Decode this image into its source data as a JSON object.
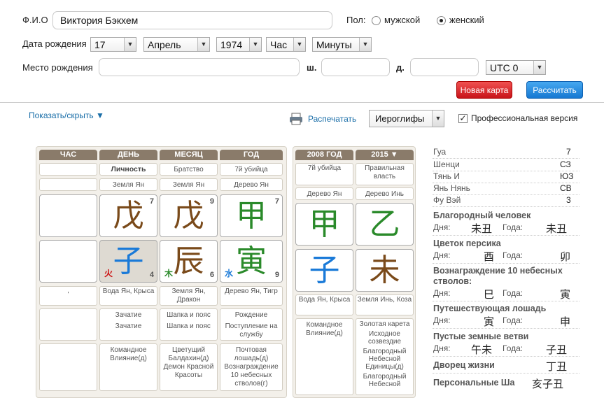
{
  "form": {
    "fio_label": "Ф.И.О",
    "fio_value": "Виктория Бэкхем",
    "gender_label": "Пол:",
    "gender_male": "мужской",
    "gender_female": "женский",
    "dob_label": "Дата рождения",
    "day": "17",
    "month": "Апрель",
    "year": "1974",
    "hour": "Час",
    "minute": "Минуты",
    "place_label": "Место рождения",
    "lat_label": "ш.",
    "lon_label": "д.",
    "tz": "UTC 0",
    "new_chart": "Новая карта",
    "calculate": "Рассчитать"
  },
  "toolbar": {
    "toggle": "Показать/скрыть ▼",
    "print": "Распечатать",
    "mode": "Иероглифы",
    "pro": "Профессиональная версия"
  },
  "pillars": {
    "headers": [
      "ЧАС",
      "ДЕНЬ",
      "МЕСЯЦ",
      "ГОД"
    ],
    "roles": [
      "",
      "Личность",
      "Братство",
      "7й убийца"
    ],
    "stems_desc": [
      "",
      "Земля Ян",
      "Земля Ян",
      "Дерево Ян"
    ],
    "stems": [
      {
        "glyph": "",
        "num": ""
      },
      {
        "glyph": "戊",
        "num": "7"
      },
      {
        "glyph": "戊",
        "num": "9"
      },
      {
        "glyph": "甲",
        "num": "7"
      }
    ],
    "branches": [
      {
        "glyph": "",
        "num": "",
        "el": ""
      },
      {
        "glyph": "子",
        "num": "4",
        "el": "火"
      },
      {
        "glyph": "辰",
        "num": "6",
        "el": "木"
      },
      {
        "glyph": "寅",
        "num": "9",
        "el": "水"
      }
    ],
    "branch_desc": [
      "'",
      "Вода Ян, Крыса",
      "Земля Ян, Дракон",
      "Дерево Ян, Тигр"
    ],
    "stars1": [
      [],
      [
        "Зачатие",
        "Зачатие"
      ],
      [
        "Шапка и пояс",
        "Шапка и пояс"
      ],
      [
        "Рождение",
        "Поступление на службу"
      ]
    ],
    "stars2": [
      "",
      "Командное Влияние(д)",
      "Цветущий Балдахин(д) Демон Красной Красоты",
      "Почтовая лошадь(д) Вознаграждение 10 небесных стволов(г)"
    ]
  },
  "luck": {
    "headers": [
      "2008 ГОД",
      "2015 ▼"
    ],
    "roles": [
      "7й убийца",
      "Правильная власть"
    ],
    "stems_desc": [
      "Дерево Ян",
      "Дерево Инь"
    ],
    "stems": [
      "甲",
      "乙"
    ],
    "branches": [
      "子",
      "未"
    ],
    "branch_desc": [
      "Вода Ян, Крыса",
      "Земля Инь, Коза"
    ],
    "stars_left": "Командное Влияние(д)",
    "stars_right": [
      "Золотая карета",
      "Исходное созвездие",
      "Благородный Небесной Единицы(д)",
      "Благородный Небесной"
    ]
  },
  "side": {
    "rows": [
      {
        "k": "Гуа",
        "v": "7"
      },
      {
        "k": "Шенци",
        "v": "СЗ"
      },
      {
        "k": "Тянь И",
        "v": "ЮЗ"
      },
      {
        "k": "Янь Нянь",
        "v": "СВ"
      },
      {
        "k": "Фу Вэй",
        "v": "3"
      }
    ],
    "day_label": "Дня:",
    "year_label": "Года:",
    "noble": {
      "title": "Благородный человек",
      "day": "未丑",
      "year": "未丑"
    },
    "peach": {
      "title": "Цветок персика",
      "day": "酉",
      "year": "卯"
    },
    "reward": {
      "title": "Вознаграждение 10 небесных стволов:",
      "day": "巳",
      "year": "寅"
    },
    "horse": {
      "title": "Путешествующая лошадь",
      "day": "寅",
      "year": "申"
    },
    "empty": {
      "title": "Пустые земные ветви",
      "day": "午未",
      "year": "子丑"
    },
    "palace": {
      "title": "Дворец жизни",
      "v": "丁丑"
    },
    "sha": {
      "title": "Персональные Ша",
      "v": "亥子丑"
    }
  }
}
